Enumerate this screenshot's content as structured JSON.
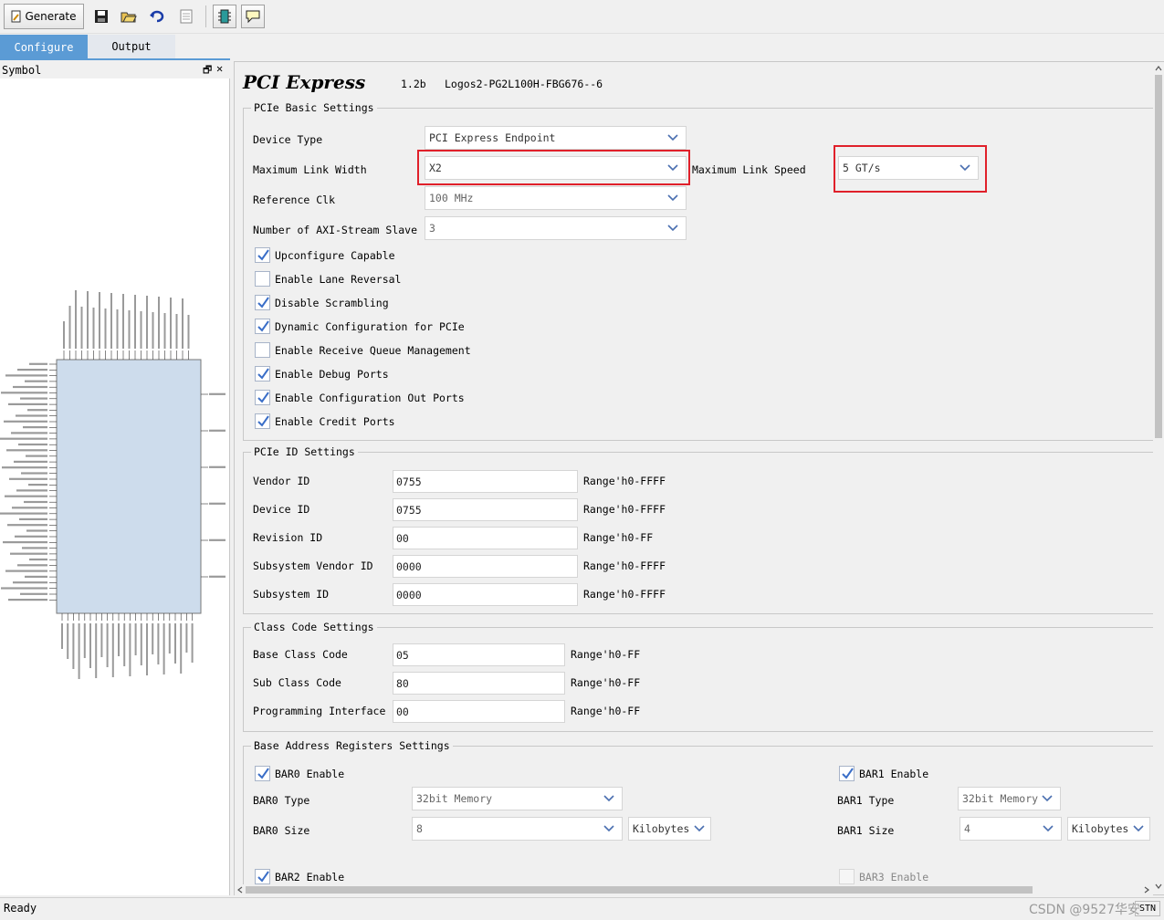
{
  "toolbar": {
    "generate_label": "Generate",
    "icons": [
      "save-icon",
      "open-folder-icon",
      "refresh-icon",
      "document-icon",
      "chip-icon",
      "comment-icon"
    ]
  },
  "tabs": [
    {
      "label": "Configure",
      "active": true
    },
    {
      "label": "Output",
      "active": false
    }
  ],
  "symbol_panel": {
    "title": "Symbol",
    "restore_glyph": "🗗",
    "close_glyph": "✕"
  },
  "header": {
    "title": "PCI Express",
    "version": "1.2b",
    "device": "Logos2-PG2L100H-FBG676--6"
  },
  "basic": {
    "title": "PCIe Basic Settings",
    "device_type_label": "Device Type",
    "device_type_value": "PCI Express Endpoint",
    "max_link_width_label": "Maximum Link Width",
    "max_link_width_value": "X2",
    "max_link_speed_label": "Maximum Link Speed",
    "max_link_speed_value": "5 GT/s",
    "ref_clk_label": "Reference Clk",
    "ref_clk_value": "100 MHz",
    "axi_slave_label": "Number of AXI-Stream Slave",
    "axi_slave_value": "3",
    "checks": [
      {
        "label": "Upconfigure Capable",
        "checked": true
      },
      {
        "label": "Enable Lane Reversal",
        "checked": false
      },
      {
        "label": "Disable Scrambling",
        "checked": true
      },
      {
        "label": "Dynamic Configuration for PCIe",
        "checked": true
      },
      {
        "label": "Enable Receive Queue Management",
        "checked": false
      },
      {
        "label": "Enable Debug Ports",
        "checked": true
      },
      {
        "label": "Enable Configuration Out Ports",
        "checked": true
      },
      {
        "label": "Enable Credit Ports",
        "checked": true
      }
    ]
  },
  "ids": {
    "title": "PCIe ID Settings",
    "rows": [
      {
        "label": "Vendor ID",
        "value": "0755",
        "range": "Range'h0-FFFF"
      },
      {
        "label": "Device ID",
        "value": "0755",
        "range": "Range'h0-FFFF"
      },
      {
        "label": "Revision ID",
        "value": "00",
        "range": "Range'h0-FF"
      },
      {
        "label": "Subsystem Vendor ID",
        "value": "0000",
        "range": "Range'h0-FFFF"
      },
      {
        "label": "Subsystem ID",
        "value": "0000",
        "range": "Range'h0-FFFF"
      }
    ]
  },
  "class_code": {
    "title": "Class Code Settings",
    "rows": [
      {
        "label": "Base Class Code",
        "value": "05",
        "range": "Range'h0-FF"
      },
      {
        "label": "Sub Class Code",
        "value": "80",
        "range": "Range'h0-FF"
      },
      {
        "label": "Programming Interface",
        "value": "00",
        "range": "Range'h0-FF"
      }
    ]
  },
  "bars": {
    "title": "Base Address Registers Settings",
    "bar0_enable": "BAR0 Enable",
    "bar0_type_label": "BAR0 Type",
    "bar0_type_value": "32bit Memory",
    "bar0_size_label": "BAR0 Size",
    "bar0_size_value": "8",
    "bar0_unit": "Kilobytes",
    "bar1_enable": "BAR1 Enable",
    "bar1_type_label": "BAR1 Type",
    "bar1_type_value": "32bit Memory",
    "bar1_size_label": "BAR1 Size",
    "bar1_size_value": "4",
    "bar1_unit": "Kilobytes",
    "bar2_enable": "BAR2 Enable",
    "bar3_enable": "BAR3 Enable"
  },
  "status": {
    "text": "Ready",
    "right": "STN",
    "watermark": "CSDN @9527华安"
  }
}
